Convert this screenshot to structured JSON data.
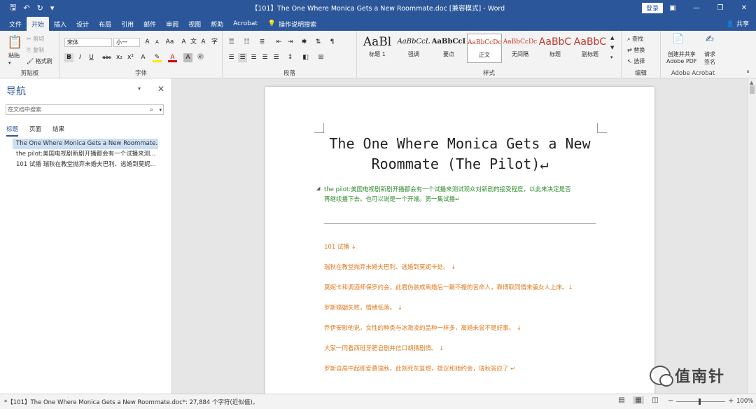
{
  "window": {
    "title": "【101】The One Where Monica Gets a New Roommate.doc [兼容模式] - Word",
    "login_label": "登录",
    "share_label": "共享"
  },
  "tabs": [
    "文件",
    "开始",
    "插入",
    "设计",
    "布局",
    "引用",
    "邮件",
    "审阅",
    "视图",
    "帮助",
    "Acrobat"
  ],
  "tell_me": "操作说明搜索",
  "ribbon": {
    "clipboard": {
      "paste": "粘贴",
      "cut": "剪切",
      "copy": "复制",
      "format_painter": "格式刷",
      "label": "剪贴板"
    },
    "font": {
      "name": "宋体",
      "size": "小一",
      "label": "字体"
    },
    "paragraph": {
      "label": "段落"
    },
    "styles": {
      "label": "样式",
      "items": [
        {
          "sample": "AaBl",
          "name": "标题 1"
        },
        {
          "sample": "AaBbCcL",
          "name": "强调"
        },
        {
          "sample": "AaBbCcI",
          "name": "要点"
        },
        {
          "sample": "AaBbCcDc",
          "name": "正文"
        },
        {
          "sample": "AaBbCcDc",
          "name": "无间隔"
        },
        {
          "sample": "AaBbC",
          "name": "标题"
        },
        {
          "sample": "AaBbC",
          "name": "副标题"
        }
      ]
    },
    "editing": {
      "find": "查找",
      "replace": "替换",
      "select": "选择",
      "label": "编辑"
    },
    "acrobat": {
      "create_share": "创建并共享",
      "adobe_pdf": "Adobe PDF",
      "request_sign_1": "请求",
      "request_sign_2": "签名",
      "label": "Adobe Acrobat"
    }
  },
  "nav": {
    "title": "导航",
    "search_placeholder": "在文档中搜索",
    "tabs": [
      "标题",
      "页面",
      "结果"
    ],
    "items": [
      "The One Where Monica Gets a New Roommate...",
      "the pilot:美国电视剧新剧开播都会有一个试播来测...",
      "101 试播 瑞秋在教堂抛弃未婚夫巴利、逃婚到莫妮..."
    ]
  },
  "document": {
    "title_line1": "The One Where Monica Gets a New",
    "title_line2": "Roommate (The Pilot)↵",
    "intro_line1": "the pilot:美国电视剧新剧开播都会有一个试播来测试观众对新剧的接受程度，以此来决定是否",
    "intro_line2": "再继续播下去。也可以说是一个开端。第一集试播↵",
    "lines": [
      "101   试播 ↓",
      "瑞秋在教堂抛弃未婚夫巴利、逃婚到莫妮卡处。 ↓",
      "莫妮卡和调酒师保罗约会，此君伪装成离婚后一蹶不振的苦命人，靠博取同情来骗女人上床。↓",
      "罗斯婚姻失败，情绪低落。 ↓",
      "乔伊安慰他说，女性的种类与冰激凌的品种一样多，离婚未尝不是好事。 ↓",
      "大家一同看西班牙肥皂剧并信口胡猜剧情。 ↓",
      "罗斯自高中起即爱慕瑞秋，此刻死灰复燃，提议和她约会，瑞秋答应了 ↵"
    ]
  },
  "watermark": "值南针",
  "status": {
    "text": "*【101】The One Where Monica Gets a New Roommate.doc*: 27,884 个字符(近似值)。",
    "zoom": "100%"
  }
}
